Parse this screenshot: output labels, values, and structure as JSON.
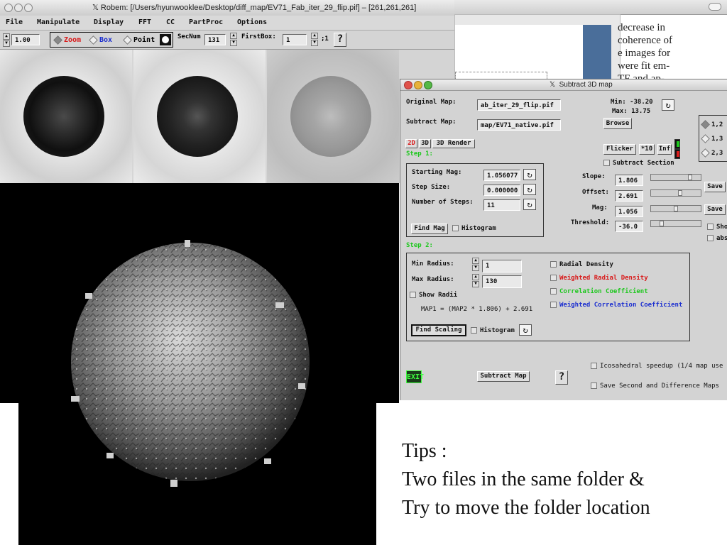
{
  "background_doc": {
    "text_lines": [
      "decrease in",
      "coherence of",
      "e images for",
      "were fit em-",
      "TF and ap-"
    ]
  },
  "robem": {
    "title": "Robem: [/Users/hyunwooklee/Desktop/diff_map/EV71_Fab_iter_29_flip.pif] – [261,261,261]",
    "menu": [
      "File",
      "Manipulate",
      "Display",
      "FFT",
      "CC",
      "PartProc",
      "Options"
    ],
    "toolbar": {
      "zoom_value": "1.00",
      "modes": [
        {
          "label": "Zoom",
          "color": "#d81b1b"
        },
        {
          "label": "Box",
          "color": "#1c2fd0"
        },
        {
          "label": "Point",
          "color": "#111111"
        }
      ],
      "secnum_label": "SecNum",
      "secnum_value": "131",
      "firstbox_label": "FirstBox:",
      "firstbox_value": "1",
      "step_label": ";1",
      "help": "?"
    }
  },
  "subtract": {
    "title": "Subtract 3D map",
    "original_label": "Original Map:",
    "original_value": "ab_iter_29_flip.pif",
    "subtract_label": "Subtract Map:",
    "subtract_value": "map/EV71_native.pif",
    "min_text": "Min: -38.20",
    "max_text": "Max: 13.75",
    "browse": "Browse",
    "view_buttons": [
      "2D",
      "3D",
      "3D Render"
    ],
    "step1": "Step 1:",
    "flicker": "Flicker",
    "x10": "*10",
    "inf": "Inf",
    "radio_options": [
      "1,2",
      "1,3",
      "2,3"
    ],
    "subtract_section": "Subtract Section",
    "starting_mag_label": "Starting Mag:",
    "starting_mag_value": "1.056077",
    "step_size_label": "Step Size:",
    "step_size_value": "0.000000",
    "num_steps_label": "Number of Steps:",
    "num_steps_value": "11",
    "find_mag": "Find Mag",
    "histogram": "Histogram",
    "slope_label": "Slope:",
    "slope_value": "1.806",
    "offset_label": "Offset:",
    "offset_value": "2.691",
    "mag_label": "Mag:",
    "mag_value": "1.056",
    "threshold_label": "Threshold:",
    "threshold_value": "-36.0",
    "save": "Save",
    "show_partial": "Sho",
    "abs_partial": "abs",
    "step2": "Step 2:",
    "min_radius_label": "Min Radius:",
    "min_radius_value": "1",
    "max_radius_label": "Max Radius:",
    "max_radius_value": "130",
    "show_radii": "Show Radii",
    "formula": "MAP1 = (MAP2 * 1.806) + 2.691",
    "find_scaling": "Find Scaling",
    "options": [
      {
        "label": "Radial Density",
        "color": "#111111"
      },
      {
        "label": "Weighted Radial Density",
        "color": "#d81b1b"
      },
      {
        "label": "Correlation Coefficient",
        "color": "#1ec71e"
      },
      {
        "label": "Weighted Correlation Coefficient",
        "color": "#1c2fd0"
      }
    ],
    "icosahedral": "Icosahedral speedup (1/4 map use",
    "save_second": "Save Second and Difference Maps",
    "exit": "EXIT",
    "subtract_map": "Subtract Map",
    "help": "?"
  },
  "tips": {
    "line1": "Tips :",
    "line2": "Two files in the same folder &",
    "line3": "Try to move the folder location"
  }
}
